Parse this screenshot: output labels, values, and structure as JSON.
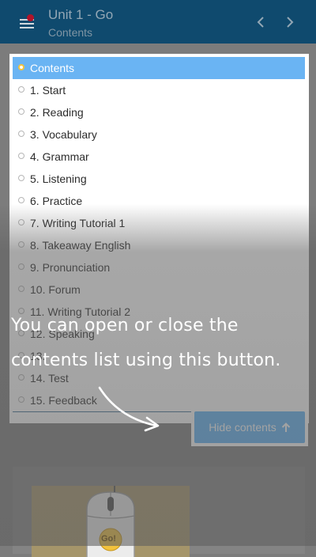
{
  "header": {
    "title": "Unit 1 - Go",
    "subtitle": "Contents",
    "menu_icon": "menu-icon",
    "prev_icon": "chevron-left-icon",
    "next_icon": "chevron-right-icon"
  },
  "toc": {
    "items": [
      {
        "label": "Contents",
        "active": true
      },
      {
        "label": "1. Start"
      },
      {
        "label": "2. Reading"
      },
      {
        "label": "3. Vocabulary"
      },
      {
        "label": "4. Grammar"
      },
      {
        "label": "5. Listening"
      },
      {
        "label": "6. Practice"
      },
      {
        "label": "7. Writing Tutorial 1"
      },
      {
        "label": "8. Takeaway English"
      },
      {
        "label": "9. Pronunciation"
      },
      {
        "label": "10. Forum"
      },
      {
        "label": "11. Writing Tutorial 2"
      },
      {
        "label": "12. Speaking"
      },
      {
        "label": "13. "
      },
      {
        "label": "14. Test"
      },
      {
        "label": "15. Feedback"
      }
    ]
  },
  "hide_button": {
    "label": "Hide contents",
    "icon": "arrow-up-icon"
  },
  "tip": {
    "line1": "You can open or close the",
    "line2": "contents list using this button."
  },
  "image": {
    "badge": "Go!"
  },
  "colors": {
    "header": "#0f4a6e",
    "active_item": "#6ab4f3",
    "button": "#5cb1f5"
  }
}
